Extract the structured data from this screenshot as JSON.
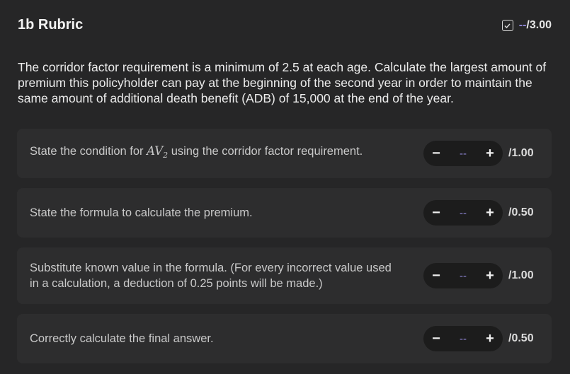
{
  "header": {
    "title": "1b Rubric",
    "score_value": "--",
    "score_max": "/3.00"
  },
  "prompt": "The corridor factor requirement is a minimum of 2.5 at each age. Calculate the largest amount of premium this policyholder can pay at the beginning of the second year in order to maintain the same amount of additional death benefit (ADB) of 15,000 at the end of the year.",
  "items": [
    {
      "label_pre": "State the condition for ",
      "label_math": "AV",
      "label_sub": "2",
      "label_post": " using the corridor factor requirement.",
      "value": "--",
      "max": "/1.00",
      "minus": "−",
      "plus": "+"
    },
    {
      "label": "State the formula to calculate the premium.",
      "value": "--",
      "max": "/0.50",
      "minus": "−",
      "plus": "+"
    },
    {
      "label": "Substitute known value in the formula. (For every incorrect value used in a calculation, a deduction of 0.25 points will be made.)",
      "value": "--",
      "max": "/1.00",
      "minus": "−",
      "plus": "+"
    },
    {
      "label": "Correctly calculate the final answer.",
      "value": "--",
      "max": "/0.50",
      "minus": "−",
      "plus": "+"
    }
  ],
  "colors": {
    "accent": "#8f86d6",
    "card": "#2d2d2e",
    "background": "#262627"
  },
  "icons": {
    "header": "checkbox-icon"
  }
}
